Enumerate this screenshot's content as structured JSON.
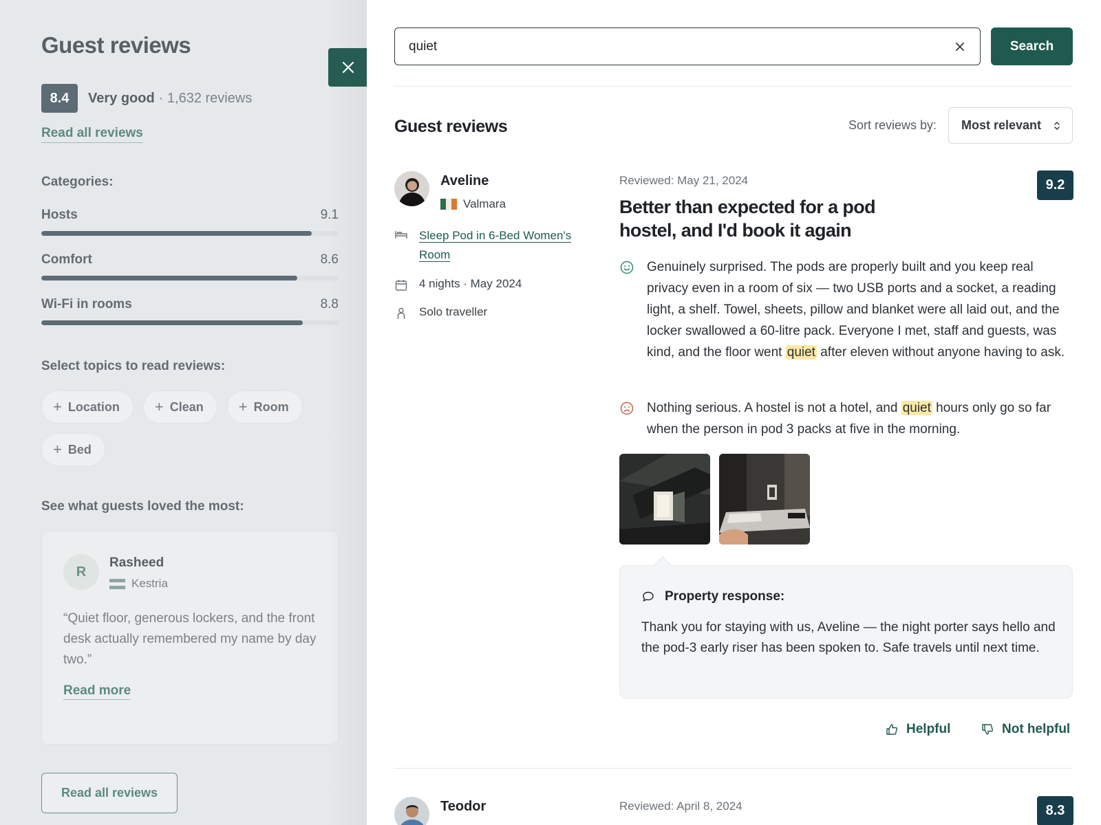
{
  "sidebar": {
    "title": "Guest reviews",
    "score": "8.4",
    "score_label": "Very good",
    "score_count": "· 1,632 reviews",
    "read_all_link": "Read all reviews",
    "categories_heading": "Categories:",
    "categories": [
      {
        "name": "Hosts",
        "value": "9.1",
        "fraction": 0.91
      },
      {
        "name": "Comfort",
        "value": "8.6",
        "fraction": 0.86
      },
      {
        "name": "Wi-Fi in rooms",
        "value": "8.8",
        "fraction": 0.88
      }
    ],
    "topics_heading": "Select topics to read reviews:",
    "topics": [
      "Location",
      "Clean",
      "Room",
      "Bed"
    ],
    "loved_heading": "See what guests loved the most:",
    "loved_card": {
      "initial": "R",
      "name": "Rasheed",
      "country": "Kestria",
      "quote": "“Quiet floor, generous lockers, and the front desk actually remembered my name by day two.”",
      "read_more": "Read more"
    },
    "read_all_button": "Read all reviews"
  },
  "search": {
    "value": "quiet",
    "button": "Search"
  },
  "main": {
    "heading": "Guest reviews",
    "sort_label": "Sort reviews by:",
    "sort_value": "Most relevant",
    "reviews": [
      {
        "name": "Aveline",
        "country": "Valmara",
        "room": "Sleep Pod in 6-Bed Women's Room",
        "stay": "4 nights · May 2024",
        "traveller": "Solo traveller",
        "reviewed": "Reviewed: May 21, 2024",
        "score": "9.2",
        "title": "Better than expected for a pod hostel, and I'd book it again",
        "positive_before": "Genuinely surprised. The pods are properly built and you keep real privacy even in a room of six — two USB ports and a socket, a reading light, a shelf. Towel, sheets, pillow and blanket were all laid out, and the locker swallowed a 60-litre pack. Everyone I met, staff and guests, was kind, and the floor went ",
        "positive_highlight": "quiet",
        "positive_after": " after eleven without anyone having to ask.",
        "negative_before": "Nothing serious. A hostel is not a hotel, and ",
        "negative_highlight": "quiet",
        "negative_after": " hours only go so far when the person in pod 3 packs at five in the morning.",
        "response_heading": "Property response:",
        "response_text": "Thank you for staying with us, Aveline — the night porter says hello and the pod-3 early riser has been spoken to. Safe travels until next time.",
        "helpful": "Helpful",
        "not_helpful": "Not helpful"
      },
      {
        "name": "Teodor",
        "reviewed": "Reviewed: April 8, 2024",
        "score": "8.3"
      }
    ]
  },
  "colors": {
    "brand": "#1f5a50",
    "score_badge": "#173e4a",
    "highlight": "#fde8a6"
  },
  "icons": [
    "close-icon",
    "clear-icon",
    "sort-chevrons-icon",
    "bed-icon",
    "calendar-icon",
    "person-icon",
    "smile-icon",
    "frown-icon",
    "speech-bubble-icon",
    "thumbs-up-icon",
    "thumbs-down-icon",
    "plus-icon"
  ]
}
